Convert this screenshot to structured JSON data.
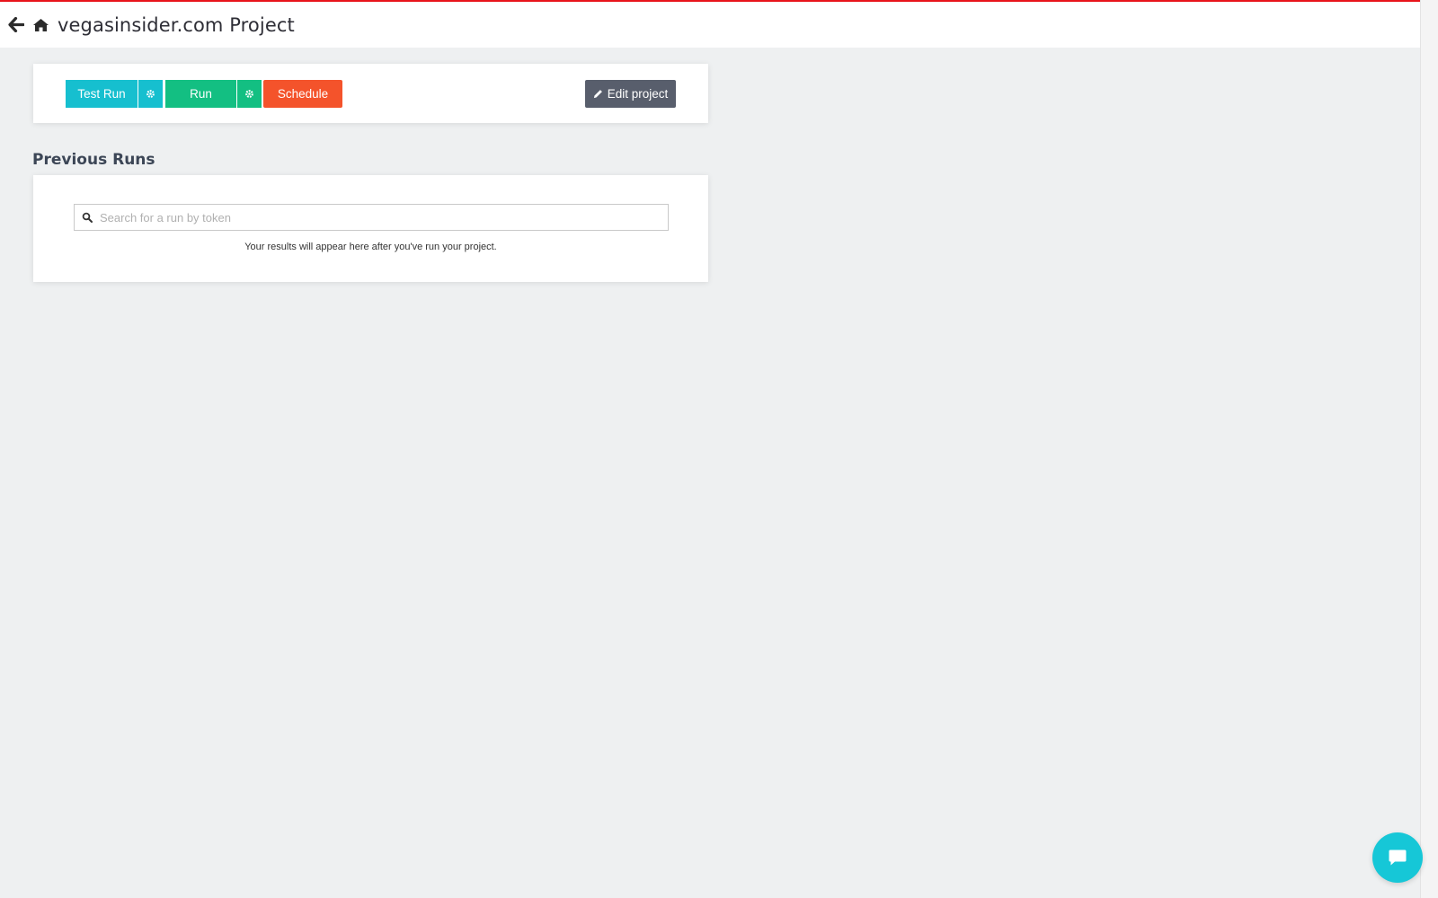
{
  "header": {
    "back_icon": "arrow-left-icon",
    "home_icon": "home-icon",
    "title": "vegasinsider.com Project"
  },
  "toolbar": {
    "test_run_label": "Test Run",
    "test_run_settings_icon": "gear-icon",
    "run_label": "Run",
    "run_settings_icon": "gear-icon",
    "schedule_label": "Schedule",
    "edit_project_label": "Edit project",
    "edit_icon": "pencil-icon"
  },
  "previous_runs": {
    "heading": "Previous Runs",
    "search": {
      "placeholder": "Search for a run by token",
      "value": "",
      "icon": "search-icon"
    },
    "empty_message": "Your results will appear here after you've run your project."
  },
  "chat": {
    "icon": "chat-bubble-icon"
  },
  "colors": {
    "accent_bar": "#e8141b",
    "test_run": "#16bfcf",
    "run": "#13bf82",
    "schedule": "#f4532b",
    "edit": "#585e6c",
    "chat": "#16c7d7"
  }
}
